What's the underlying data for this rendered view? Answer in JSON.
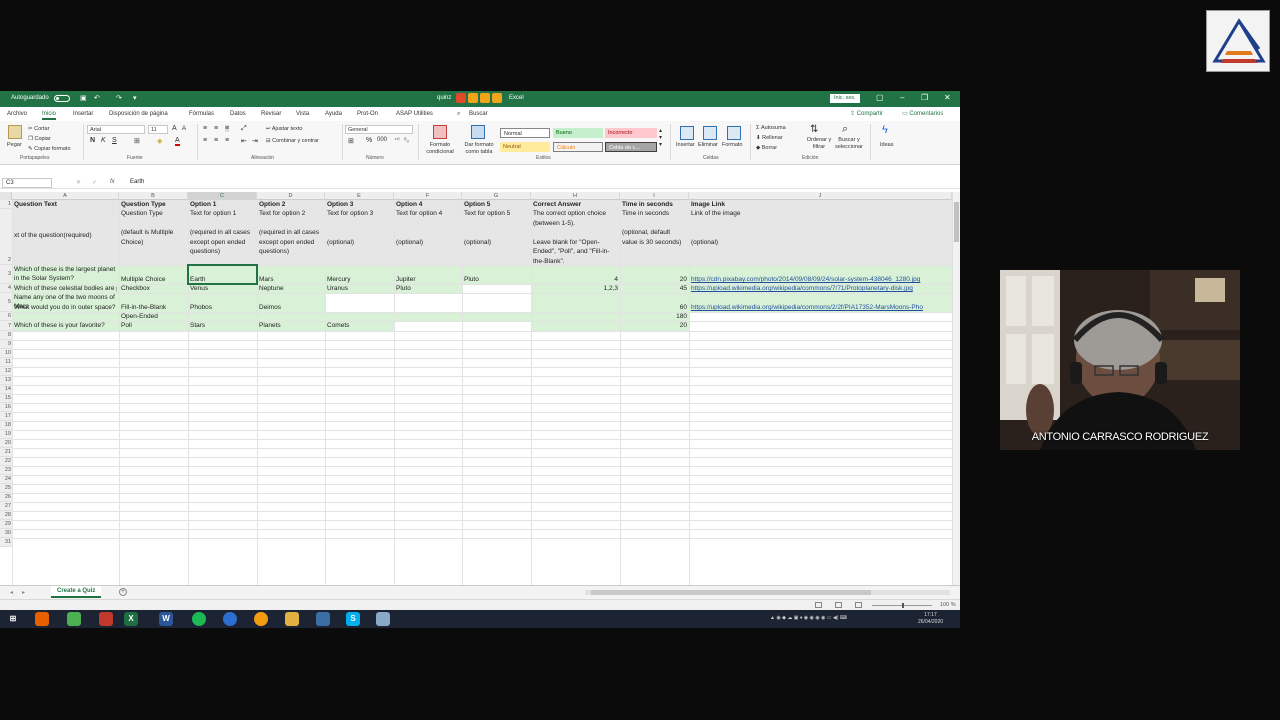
{
  "window": {
    "autosave_label": "Autoguardado",
    "title": "quinz",
    "app_name": "Excel",
    "session_button": "Inic. ses.",
    "accent_color": "#217346"
  },
  "ribbon_tabs": [
    "Archivo",
    "Inicio",
    "Insertar",
    "Disposición de página",
    "Fórmulas",
    "Datos",
    "Revisar",
    "Vista",
    "Ayuda",
    "Prot-On",
    "ASAP Utilities",
    "Buscar"
  ],
  "ribbon_actions": {
    "share": "Compartir",
    "comments": "Comentarios"
  },
  "ribbon": {
    "clipboard": {
      "paste": "Pegar",
      "cut": "Cortar",
      "copy": "Copiar",
      "format_painter": "Copiar formato",
      "label": "Portapapeles"
    },
    "font": {
      "name": "Arial",
      "size": "11",
      "label": "Fuente"
    },
    "alignment": {
      "wrap": "Ajustar texto",
      "merge": "Combinar y centrar",
      "label": "Alineación"
    },
    "number": {
      "format": "General",
      "label": "Número"
    },
    "styles": {
      "conditional": "Formato condicional",
      "as_table": "Dar formato como tabla",
      "normal": "Normal",
      "good": "Bueno",
      "bad": "Incorrecto",
      "neutral": "Neutral",
      "calc": "Cálculo",
      "check": "Celda de c...",
      "label": "Estilos"
    },
    "cells": {
      "insert": "Insertar",
      "delete": "Eliminar",
      "format": "Formato",
      "label": "Celdas"
    },
    "editing": {
      "autosum": "Autosuma",
      "fill": "Rellenar",
      "clear": "Borrar",
      "sort": "Ordenar y filtrar",
      "find": "Buscar y seleccionar",
      "label": "Edición"
    },
    "ideas": "Ideas"
  },
  "formula_bar": {
    "name_box": "C3",
    "fx": "fx",
    "value": "Earth"
  },
  "columns": [
    "A",
    "B",
    "C",
    "D",
    "E",
    "F",
    "G",
    "H",
    "I",
    "J"
  ],
  "rows": [
    "1",
    "2",
    "3",
    "4",
    "5",
    "6",
    "7",
    "8",
    "9",
    "10",
    "11",
    "12",
    "13",
    "14",
    "15",
    "16",
    "17",
    "18",
    "19",
    "20",
    "21",
    "22",
    "23",
    "24",
    "25",
    "26",
    "27",
    "28",
    "29",
    "30",
    "31"
  ],
  "headers": [
    "Question Text",
    "Question Type",
    "Option 1",
    "Option 2",
    "Option 3",
    "Option 4",
    "Option 5",
    "Correct Answer",
    "Time in seconds",
    "Image Link"
  ],
  "row2": {
    "a": "xt of the question(required)",
    "b": "Question Type\n\n(default is Multiple Choice)",
    "c": "Text for option 1\n\n(required in all cases except open ended questions)",
    "d": "Text for option 2\n\n(required in all cases except open ended questions)",
    "e": "Text for option 3\n\n\n(optional)",
    "f": "Text for option 4\n\n\n(optional)",
    "g": "Text for option 5\n\n\n(optional)",
    "h": "The correct option choice (between 1-5).\n\nLeave blank for \"Open-Ended\", \"Poll\", and \"Fill-in-the-Blank\".",
    "i": "Time in seconds\n\n(optional, default value is 30 seconds)",
    "j": "Link of the image\n\n\n(optional)"
  },
  "data_rows": [
    {
      "q": "Which of these is the largest planet in the Solar System?",
      "type": "Multiple Choice",
      "o1": "Earth",
      "o2": "Mars",
      "o3": "Mercury",
      "o4": "Jupiter",
      "o5": "Pluto",
      "ans": "4",
      "time": "20",
      "img": "https://cdn.pixabay.com/photo/2014/09/08/09/24/solar-system-438046_1280.jpg"
    },
    {
      "q": "Which of these celestial bodies are planets?",
      "type": "Checkbox",
      "o1": "Venus",
      "o2": "Neptune",
      "o3": "Uranus",
      "o4": "Pluto",
      "o5": "",
      "ans": "1,2,3",
      "time": "45",
      "img": "https://upload.wikimedia.org/wikipedia/commons/7/71/Protoplanetary-disk.jpg"
    },
    {
      "q": "Name any one of the two moons of Mars",
      "type": "Fill-in-the-Blank",
      "o1": "Phobos",
      "o2": "Deimos",
      "o3": "",
      "o4": "",
      "o5": "",
      "ans": "",
      "time": "60",
      "img": "https://upload.wikimedia.org/wikipedia/commons/2/2f/PIA17352-MarsMoons-Pho"
    },
    {
      "q": "What would you do in outer space?",
      "type": "Open-Ended",
      "o1": "",
      "o2": "",
      "o3": "",
      "o4": "",
      "o5": "",
      "ans": "",
      "time": "180",
      "img": ""
    },
    {
      "q": "Which of these is your favorite?",
      "type": "Poll",
      "o1": "Stars",
      "o2": "Planets",
      "o3": "Comets",
      "o4": "",
      "o5": "",
      "ans": "",
      "time": "20",
      "img": ""
    }
  ],
  "sheet_tab": "Create a Quiz",
  "status": {
    "zoom": "100 %"
  },
  "taskbar": {
    "time": "17:17",
    "date": "26/04/2020"
  },
  "webcam": {
    "presenter_name": "ANTONIO CARRASCO RODRIGUEZ"
  }
}
